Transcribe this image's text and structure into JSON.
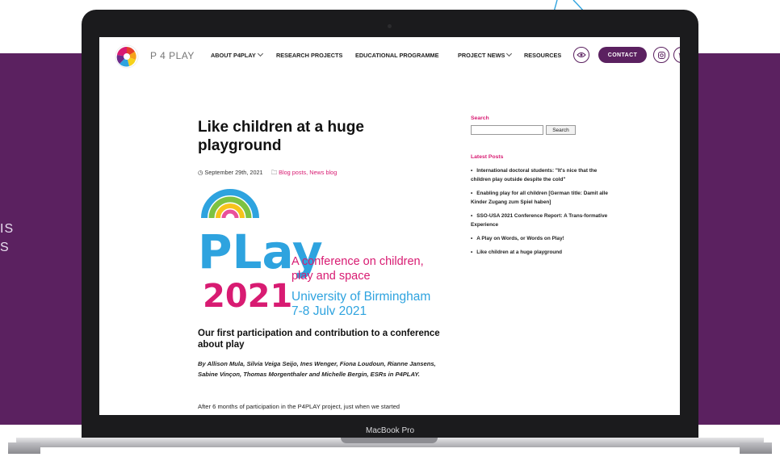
{
  "background": {
    "band_color": "#5b2160",
    "text_fragments": [
      "IS",
      "S"
    ]
  },
  "device": {
    "label": "MacBook Pro"
  },
  "site": {
    "brand": "P 4 PLAY",
    "nav": [
      {
        "label": "ABOUT P4PLAY",
        "dropdown": true
      },
      {
        "label": "RESEARCH PROJECTS",
        "dropdown": false
      },
      {
        "label": "EDUCATIONAL PROGRAMME",
        "dropdown": false
      },
      {
        "label": "PROJECT NEWS",
        "dropdown": true
      },
      {
        "label": "RESOURCES",
        "dropdown": false
      }
    ],
    "icons": {
      "eye": "eye-icon",
      "instagram": "instagram-icon",
      "twitter": "twitter-icon"
    },
    "contact_label": "CONTACT",
    "accent": "#5b2160",
    "pink": "#d81b72"
  },
  "article": {
    "title": "Like children at a huge playground",
    "date": "September 29th, 2021",
    "categories": "Blog posts, News blog",
    "graphic": {
      "word": "PLay",
      "year": "2021",
      "line1": "A conference on children,",
      "line2": "play and space",
      "line3": "University of Birmingham",
      "line4": "7-8 July 2021"
    },
    "subtitle": "Our first participation and contribution to a conference about play",
    "byline": "By Allison Mula, Silvia Veiga Seijo, Ines Wenger, Fiona Loudoun, Rianne Jansens, Sabine Vinçon, Thomas Morgenthaler and Michelle Bergin, ESRs in P4PLAY.",
    "paragraph": "After 6 months of participation in the P4PLAY project, just when we started"
  },
  "sidebar": {
    "search_label": "Search",
    "search_button": "Search",
    "search_placeholder": "",
    "latest_label": "Latest Posts",
    "posts": [
      "International doctoral students: \"It's nice that the children play outside despite the cold\"",
      "Enabling play for all children [German title: Damit alle Kinder Zugang zum Spiel haben]",
      "SSO-USA 2021 Conference Report: A Trans-formative Experience",
      "A Play on Words, or Words on Play!",
      "Like children at a huge playground"
    ]
  }
}
